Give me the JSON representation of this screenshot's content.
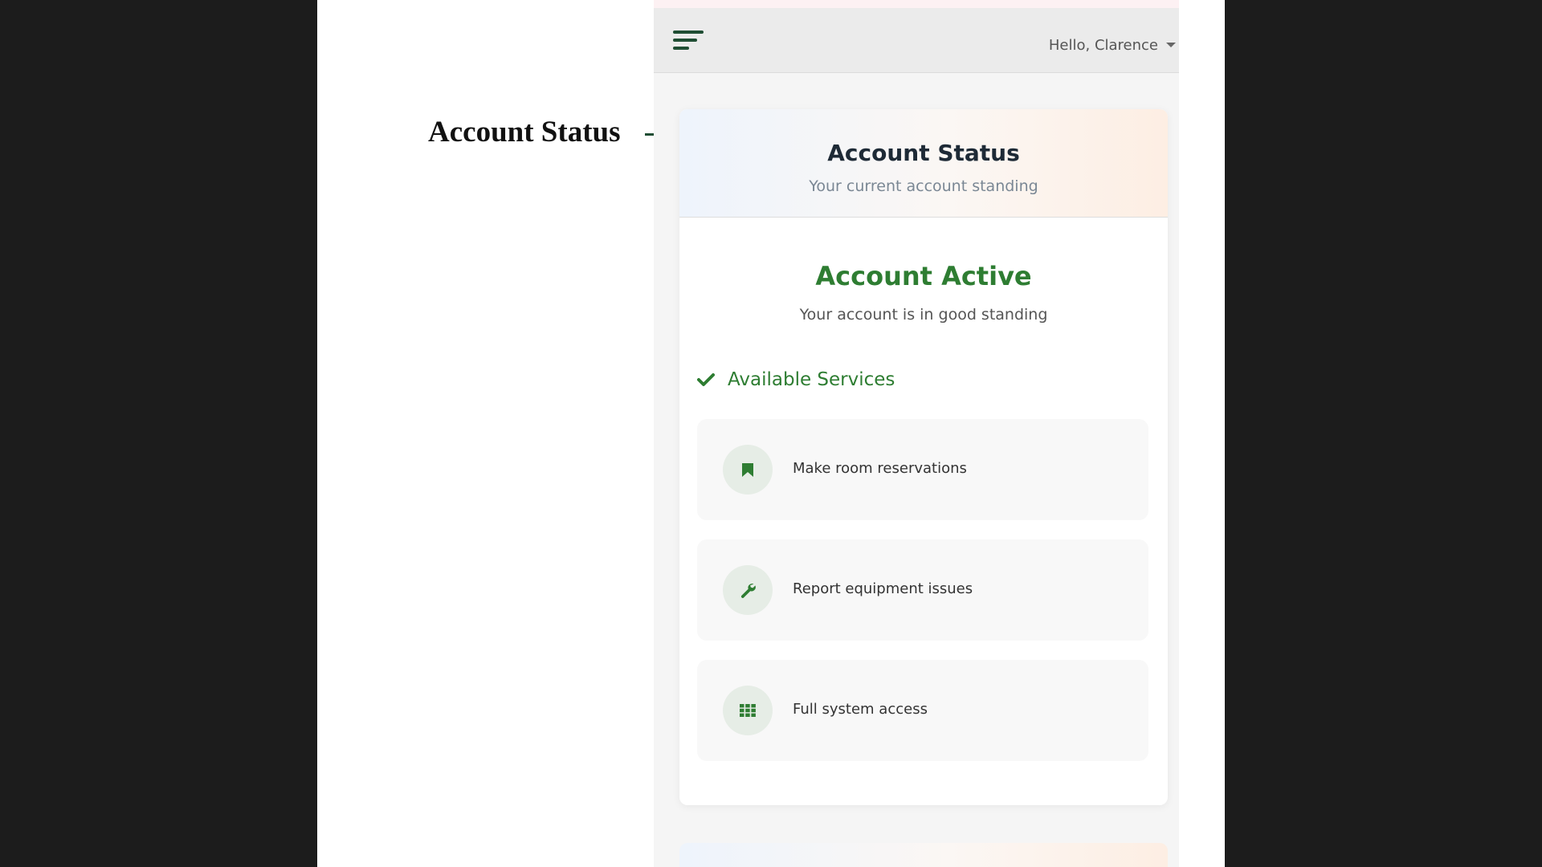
{
  "callout": {
    "label": "Account Status"
  },
  "header": {
    "menu_icon": "hamburger-menu-icon",
    "user_greeting": "Hello, Clarence"
  },
  "account_card": {
    "title": "Account Status",
    "subtitle": "Your current account standing",
    "status": "Account Active",
    "status_description": "Your account is in good standing",
    "services_heading": "Available Services",
    "services_icon": "checkmark-icon",
    "services": [
      {
        "label": "Make room reservations",
        "icon": "bookmark-icon"
      },
      {
        "label": "Report equipment issues",
        "icon": "wrench-icon"
      },
      {
        "label": "Full system access",
        "icon": "grid-icon"
      }
    ]
  },
  "colors": {
    "brand_dark_green": "#1f4d33",
    "status_green": "#2e7d32",
    "header_gradient_start": "#eef4fc",
    "header_gradient_end": "#fdeee3"
  }
}
